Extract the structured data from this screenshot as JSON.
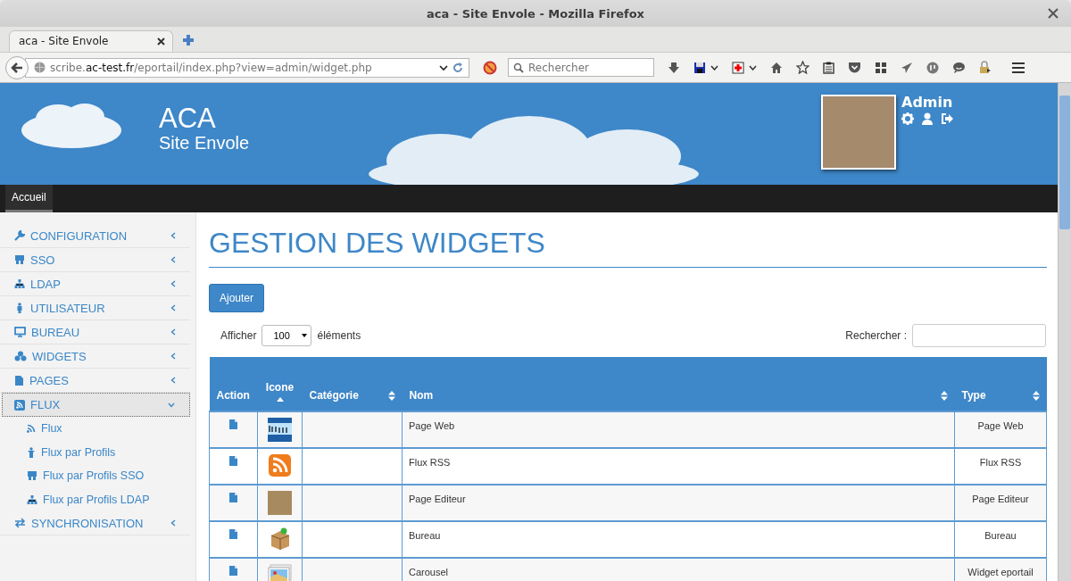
{
  "window": {
    "title": "aca - Site Envole - Mozilla Firefox"
  },
  "browser": {
    "tabs": [
      {
        "label": "aca - Site Envole",
        "selected": true
      }
    ],
    "url": "scribe.**ac-test.fr**/eportail/index.php?view=admin/widget.php",
    "search_placeholder": "Rechercher"
  },
  "site": {
    "title": "ACA",
    "subtitle": "Site Envole",
    "user": "Admin"
  },
  "nav": [
    {
      "label": "Accueil",
      "selected": true
    }
  ],
  "sidebar": {
    "items": [
      {
        "label": "CONFIGURATION",
        "expanded": false,
        "selected": false
      },
      {
        "label": "SSO",
        "expanded": false,
        "selected": false
      },
      {
        "label": "LDAP",
        "expanded": false,
        "selected": false
      },
      {
        "label": "UTILISATEUR",
        "expanded": false,
        "selected": false
      },
      {
        "label": "BUREAU",
        "expanded": false,
        "selected": false
      },
      {
        "label": "WIDGETS",
        "expanded": false,
        "selected": false
      },
      {
        "label": "PAGES",
        "expanded": false,
        "selected": false
      },
      {
        "label": "FLUX",
        "expanded": true,
        "selected": true,
        "children": [
          {
            "label": "Flux"
          },
          {
            "label": "Flux par Profils"
          },
          {
            "label": "Flux par Profils SSO"
          },
          {
            "label": "Flux par Profils LDAP"
          }
        ]
      },
      {
        "label": "SYNCHRONISATION",
        "expanded": false,
        "selected": false
      }
    ]
  },
  "main": {
    "heading": "GESTION DES WIDGETS",
    "add_button": "Ajouter",
    "length_label": "Afficher",
    "length_value": "100",
    "length_suffix": "éléments",
    "search_label": "Rechercher :",
    "table": {
      "columns": [
        {
          "label": "Action",
          "sortable": false,
          "sorted": false
        },
        {
          "label": "Icone",
          "sortable": true,
          "sorted": true
        },
        {
          "label": "Catégorie",
          "sortable": true,
          "sorted": false
        },
        {
          "label": "Nom",
          "sortable": true,
          "sorted": false
        },
        {
          "label": "Type",
          "sortable": true,
          "sorted": false
        }
      ],
      "rows": [
        {
          "name": "Page Web",
          "type": "Page Web"
        },
        {
          "name": "Flux RSS",
          "type": "Flux RSS"
        },
        {
          "name": "Page Editeur",
          "type": "Page Editeur"
        },
        {
          "name": "Bureau",
          "type": "Bureau"
        },
        {
          "name": "Carousel",
          "type": "Widget eportail"
        }
      ]
    }
  }
}
